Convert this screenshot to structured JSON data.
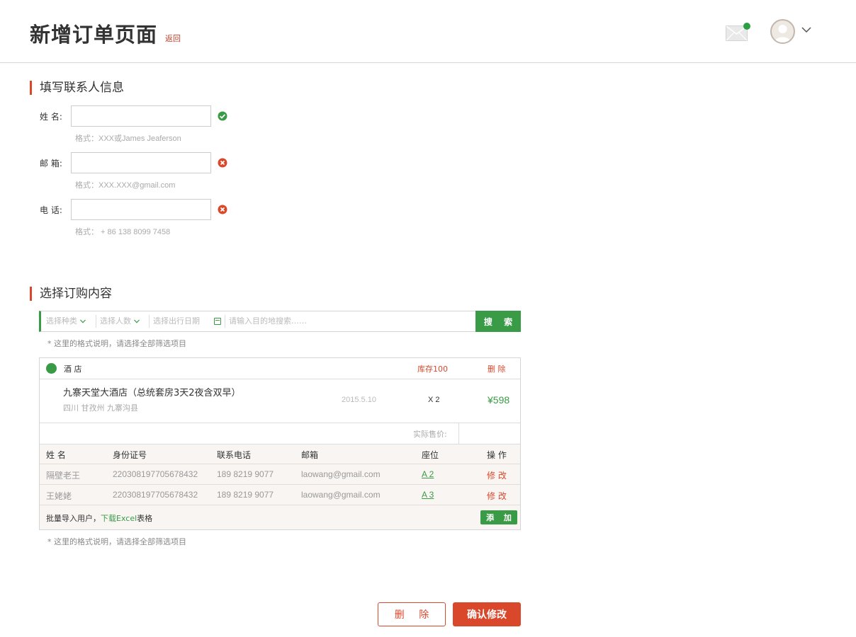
{
  "header": {
    "title": "新增订单页面",
    "back_label": "返回",
    "icons": {
      "mail": "mail-icon",
      "avatar": "user-avatar-icon",
      "menu": "chevron-down-icon"
    }
  },
  "contact": {
    "section_title": "填写联系人信息",
    "fields": [
      {
        "label": "姓   名:",
        "value": "",
        "hint": "格式：XXX或James Jeaferson",
        "status": "valid"
      },
      {
        "label": "邮   箱:",
        "value": "",
        "hint": "格式：XXX.XXX@gmail.com",
        "status": "invalid"
      },
      {
        "label": "电   话:",
        "value": "",
        "hint": "格式： + 86 138 8099 7458",
        "status": "invalid"
      }
    ]
  },
  "order": {
    "section_title": "选择订购内容",
    "filters": {
      "type": "选择种类",
      "people": "选择人数",
      "date": "选择出行日期",
      "keyword_placeholder": "请输入目的地搜索……",
      "search_label": "搜 索"
    },
    "filter_note": "* 这里的格式说明，请选择全部筛选项目",
    "category": {
      "name": "酒   店",
      "stock": "库存100",
      "delete_label": "删 除"
    },
    "item": {
      "name": "九寨天堂大酒店（总统套房3天2夜含双早）",
      "location": "四川 甘孜州 九寨沟县",
      "date": "2015.5.10",
      "quantity": "X 2",
      "price": "¥598"
    },
    "actual_price_label": "实际售价:",
    "actual_price_value": "",
    "table": {
      "headers": [
        "姓   名",
        "身份证号",
        "联系电话",
        "邮箱",
        "座位",
        "操   作"
      ],
      "rows": [
        {
          "name": "隔壁老王",
          "id": "220308197705678432",
          "phone": "189 8219 9077",
          "email": "laowang@gmail.com",
          "seat": "A 2",
          "action": "修 改"
        },
        {
          "name": "王姥姥",
          "id": "220308197705678432",
          "phone": "189 8219 9077",
          "email": "laowang@gmail.com",
          "seat": "A 3",
          "action": "修 改"
        }
      ]
    },
    "import_prefix": "批量导入用户，",
    "import_link": "下载Excel",
    "import_suffix": "表格",
    "add_label": "添 加",
    "bottom_note": "* 这里的格式说明，请选择全部筛选项目"
  },
  "actions": {
    "delete_label": "删 除",
    "confirm_label": "确认修改"
  },
  "colors": {
    "accent": "#d9482b",
    "success": "#3a9b47",
    "border": "#d5d5d5"
  }
}
